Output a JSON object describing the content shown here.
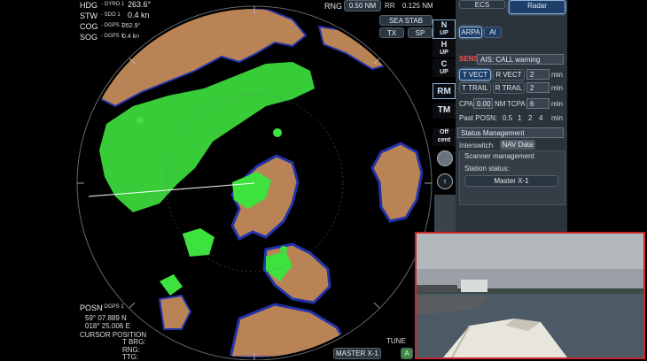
{
  "header": {
    "hdg_label": "HDG",
    "hdg_src": "- GYRO 1",
    "hdg_value": "263.6°",
    "stw_label": "STW",
    "stw_src": "- SDO 1",
    "stw_value": "0.4 kn",
    "cog_label": "COG",
    "cog_src": "- DGPS 1",
    "cog_value": "262.9°",
    "sog_label": "SOG",
    "sog_src": "- DGPS 1",
    "sog_value": "0.4 kn",
    "rng_label": "RNG",
    "rng_value": "0.50 NM",
    "rr_label": "RR",
    "rr_value": "0.125 NM",
    "sea_stab": "SEA STAB",
    "tx": "TX",
    "sp": "SP"
  },
  "side_buttons": {
    "n_up_1": "N",
    "n_up_2": "UP",
    "h_up_1": "H",
    "h_up_2": "UP",
    "c_up_1": "C",
    "c_up_2": "UP",
    "rm": "RM",
    "tm": "TM",
    "off_cent_1": "Off",
    "off_cent_2": "cent"
  },
  "panel": {
    "tab_ecs": "ECS",
    "tab_radar": "Radar",
    "arpa": "ARPA",
    "ai": "AI",
    "sens_label": "SENS",
    "ais_label": "AIS: CALL warning",
    "t_vect": "T VECT",
    "r_vect": "R VECT",
    "vect_value": "2",
    "vect_unit": "min",
    "t_trail": "T TRAIL",
    "r_trail": "R TRAIL",
    "trail_value": "2",
    "trail_unit": "min",
    "cpa_label": "CPA",
    "cpa_value": "0.00",
    "nm_label": "NM",
    "tcpa_label": "TCPA",
    "tcpa_value": "6",
    "tcpa_unit": "min",
    "past_posn_label": "Past POSN:",
    "past_opts": [
      "0.5",
      "1",
      "2",
      "4"
    ],
    "past_unit": "min",
    "status_mgmt": "Status Management",
    "interswitch": "Interswitch",
    "nav_data": "NAV Data",
    "scanner_mgmt": "Scanner management",
    "station_status": "Station status:",
    "master_x1": "Master X-1"
  },
  "bottom": {
    "posn_label": "POSN",
    "posn_src": "- DGPS 1",
    "lat": "59° 07.889 N",
    "lon": "018° 25.006 E",
    "cursor_position": "CURSOR POSITION",
    "t_brg": "T BRG:",
    "rng": "RNG:",
    "ttg": "TTG:",
    "tune": "TUNE",
    "master": "MASTER X-1",
    "a": "A"
  },
  "colors": {
    "land": "#b98356",
    "echo": "#3ee23e",
    "coast": "#2233aa",
    "panel": "#2b333b"
  }
}
